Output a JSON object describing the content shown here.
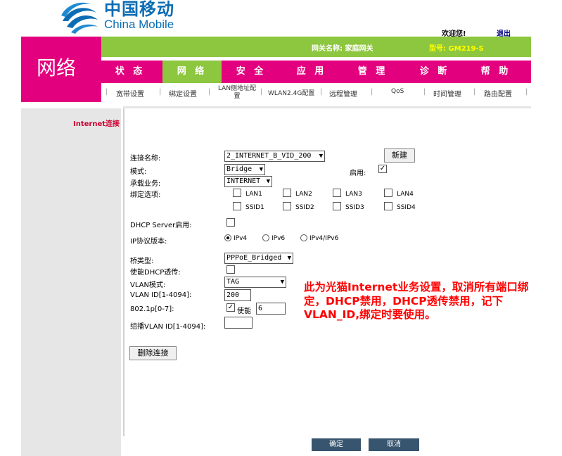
{
  "brand": {
    "name_cn": "中国移动",
    "name_en": "China Mobile"
  },
  "header": {
    "welcome": "欢迎您!",
    "logout": "退出",
    "gateway_name": "网关名称: 家庭网关",
    "model": "型号: GM219-S",
    "section_title": "网络"
  },
  "nav": {
    "items": [
      "状 态",
      "网 络",
      "安 全",
      "应 用",
      "管 理",
      "诊 断",
      "帮 助"
    ],
    "active": "网 络"
  },
  "subnav": {
    "items": [
      "宽带设置",
      "绑定设置",
      "LAN侧地址配置",
      "WLAN2.4G配置",
      "远程管理",
      "QoS",
      "时间管理",
      "路由配置"
    ]
  },
  "sidebar": {
    "active_item": "Internet连接"
  },
  "form": {
    "connection_name_label": "连接名称:",
    "connection_name_value": "2_INTERNET_B_VID_200",
    "new_button": "新建",
    "mode_label": "模式:",
    "mode_value": "Bridge",
    "enable_label": "启用:",
    "service_label": "承载业务:",
    "service_value": "INTERNET",
    "bind_label": "绑定选项:",
    "bind_options": [
      "LAN1",
      "LAN2",
      "LAN3",
      "LAN4",
      "SSID1",
      "SSID2",
      "SSID3",
      "SSID4"
    ],
    "dhcp_server_label": "DHCP Server启用:",
    "ip_version_label": "IP协议版本:",
    "ip_versions": [
      "IPv4",
      "IPv6",
      "IPv4/IPv6"
    ],
    "bridge_type_label": "桥类型:",
    "bridge_type_value": "PPPoE_Bridged",
    "dhcp_passthrough_label": "使能DHCP透传:",
    "vlan_mode_label": "VLAN模式:",
    "vlan_mode_value": "TAG",
    "vlan_id_label": "VLAN ID[1-4094]:",
    "vlan_id_value": "200",
    "priority_label": "802.1p[0-7]:",
    "priority_enable_label": "使能",
    "priority_value": "6",
    "multicast_vlan_label": "组播VLAN ID[1-4094]:",
    "multicast_vlan_value": "",
    "delete_button": "删除连接",
    "ok_button": "确定",
    "cancel_button": "取消"
  },
  "annotation": "此为光猫Internet业务设置，取消所有端口绑定，DHCP禁用，DHCP透传禁用，记下VLAN_ID,绑定时要使用。",
  "colors": {
    "magenta": "#e3007e",
    "green": "#8dc63f",
    "brand_blue": "#0b6db3",
    "annotation_red": "#ff0000",
    "button_dark": "#37556f"
  }
}
